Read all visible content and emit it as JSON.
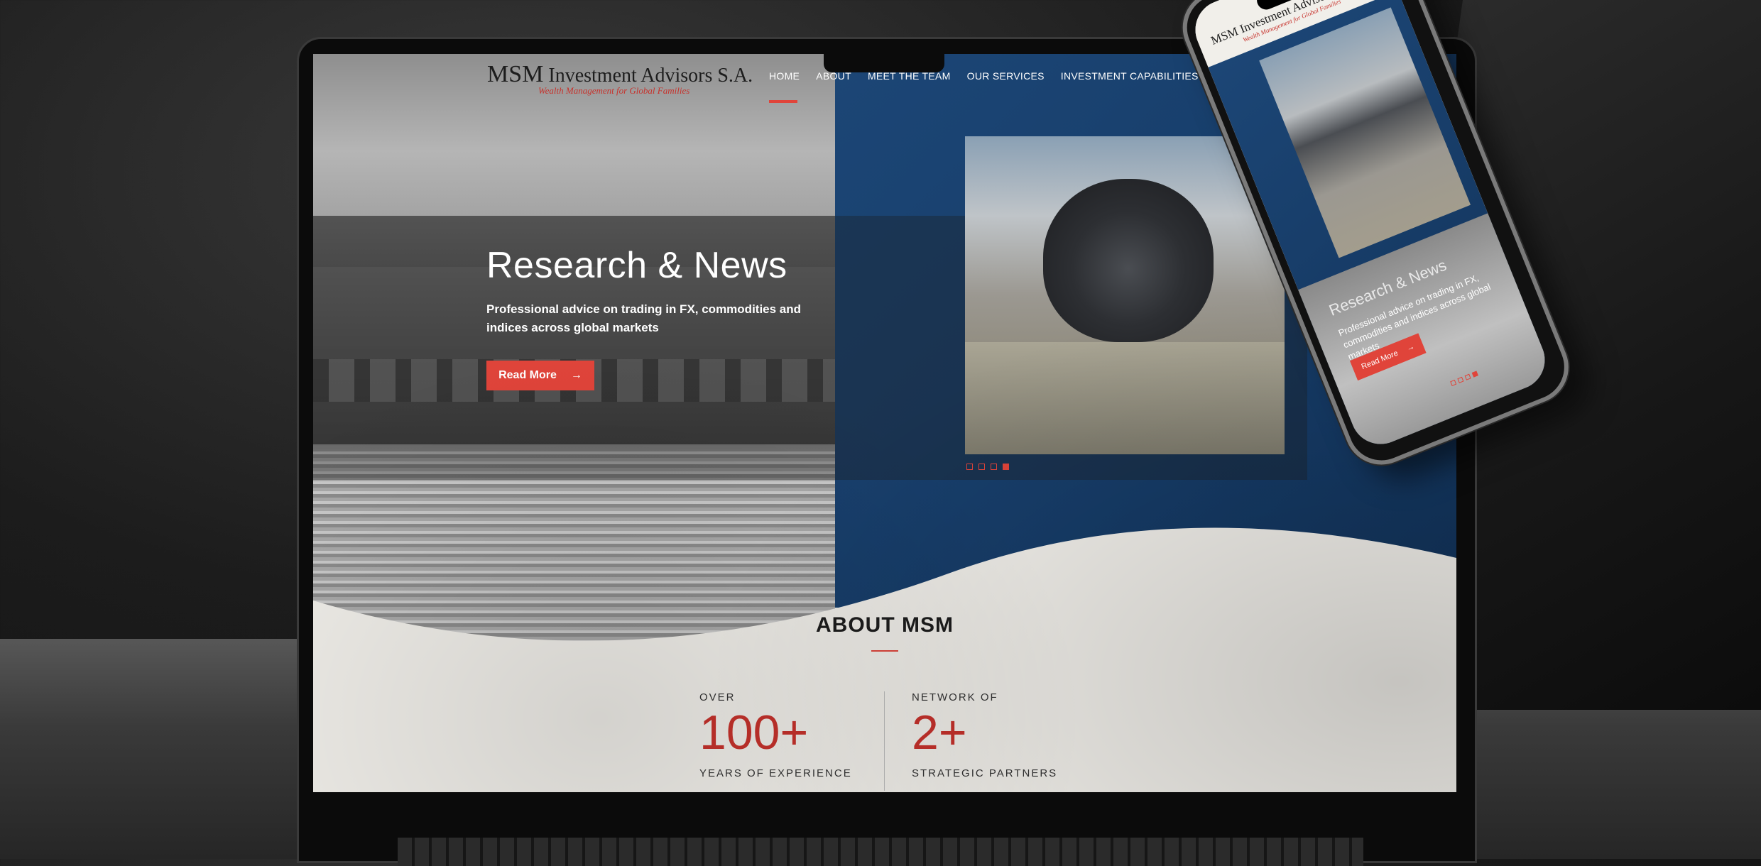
{
  "site": {
    "logo_main": "MSM",
    "logo_name": "Investment Advisors S.A.",
    "logo_tagline": "Wealth Management for Global Families"
  },
  "nav": {
    "items": [
      "HOME",
      "ABOUT",
      "MEET THE TEAM",
      "OUR SERVICES",
      "INVESTMENT CAPABILITIES"
    ],
    "active_index": 0
  },
  "hero": {
    "title": "Research & News",
    "subtitle": "Professional advice on trading in FX, commodities and indices across global markets",
    "button_label": "Read More",
    "button_arrow": "→",
    "slide_count": 4,
    "active_slide": 4
  },
  "about": {
    "title": "ABOUT MSM",
    "stats": [
      {
        "pre": "OVER",
        "number": "100+",
        "post": "YEARS OF EXPERIENCE"
      },
      {
        "pre": "NETWORK OF",
        "number": "2+",
        "post": "STRATEGIC PARTNERS"
      }
    ]
  },
  "mobile": {
    "logo_main": "MSM",
    "logo_name": "Investment Advisors S.A.",
    "logo_tagline": "Wealth Management for Global Families",
    "hero_title": "Research & News",
    "hero_subtitle": "Professional advice on trading in FX, commodities and indices across global markets",
    "button_label": "Read More",
    "button_arrow": "→"
  },
  "colors": {
    "accent": "#e0443a",
    "navy": "#163c68",
    "stat_red": "#c7322c",
    "background": "#f1efea"
  }
}
